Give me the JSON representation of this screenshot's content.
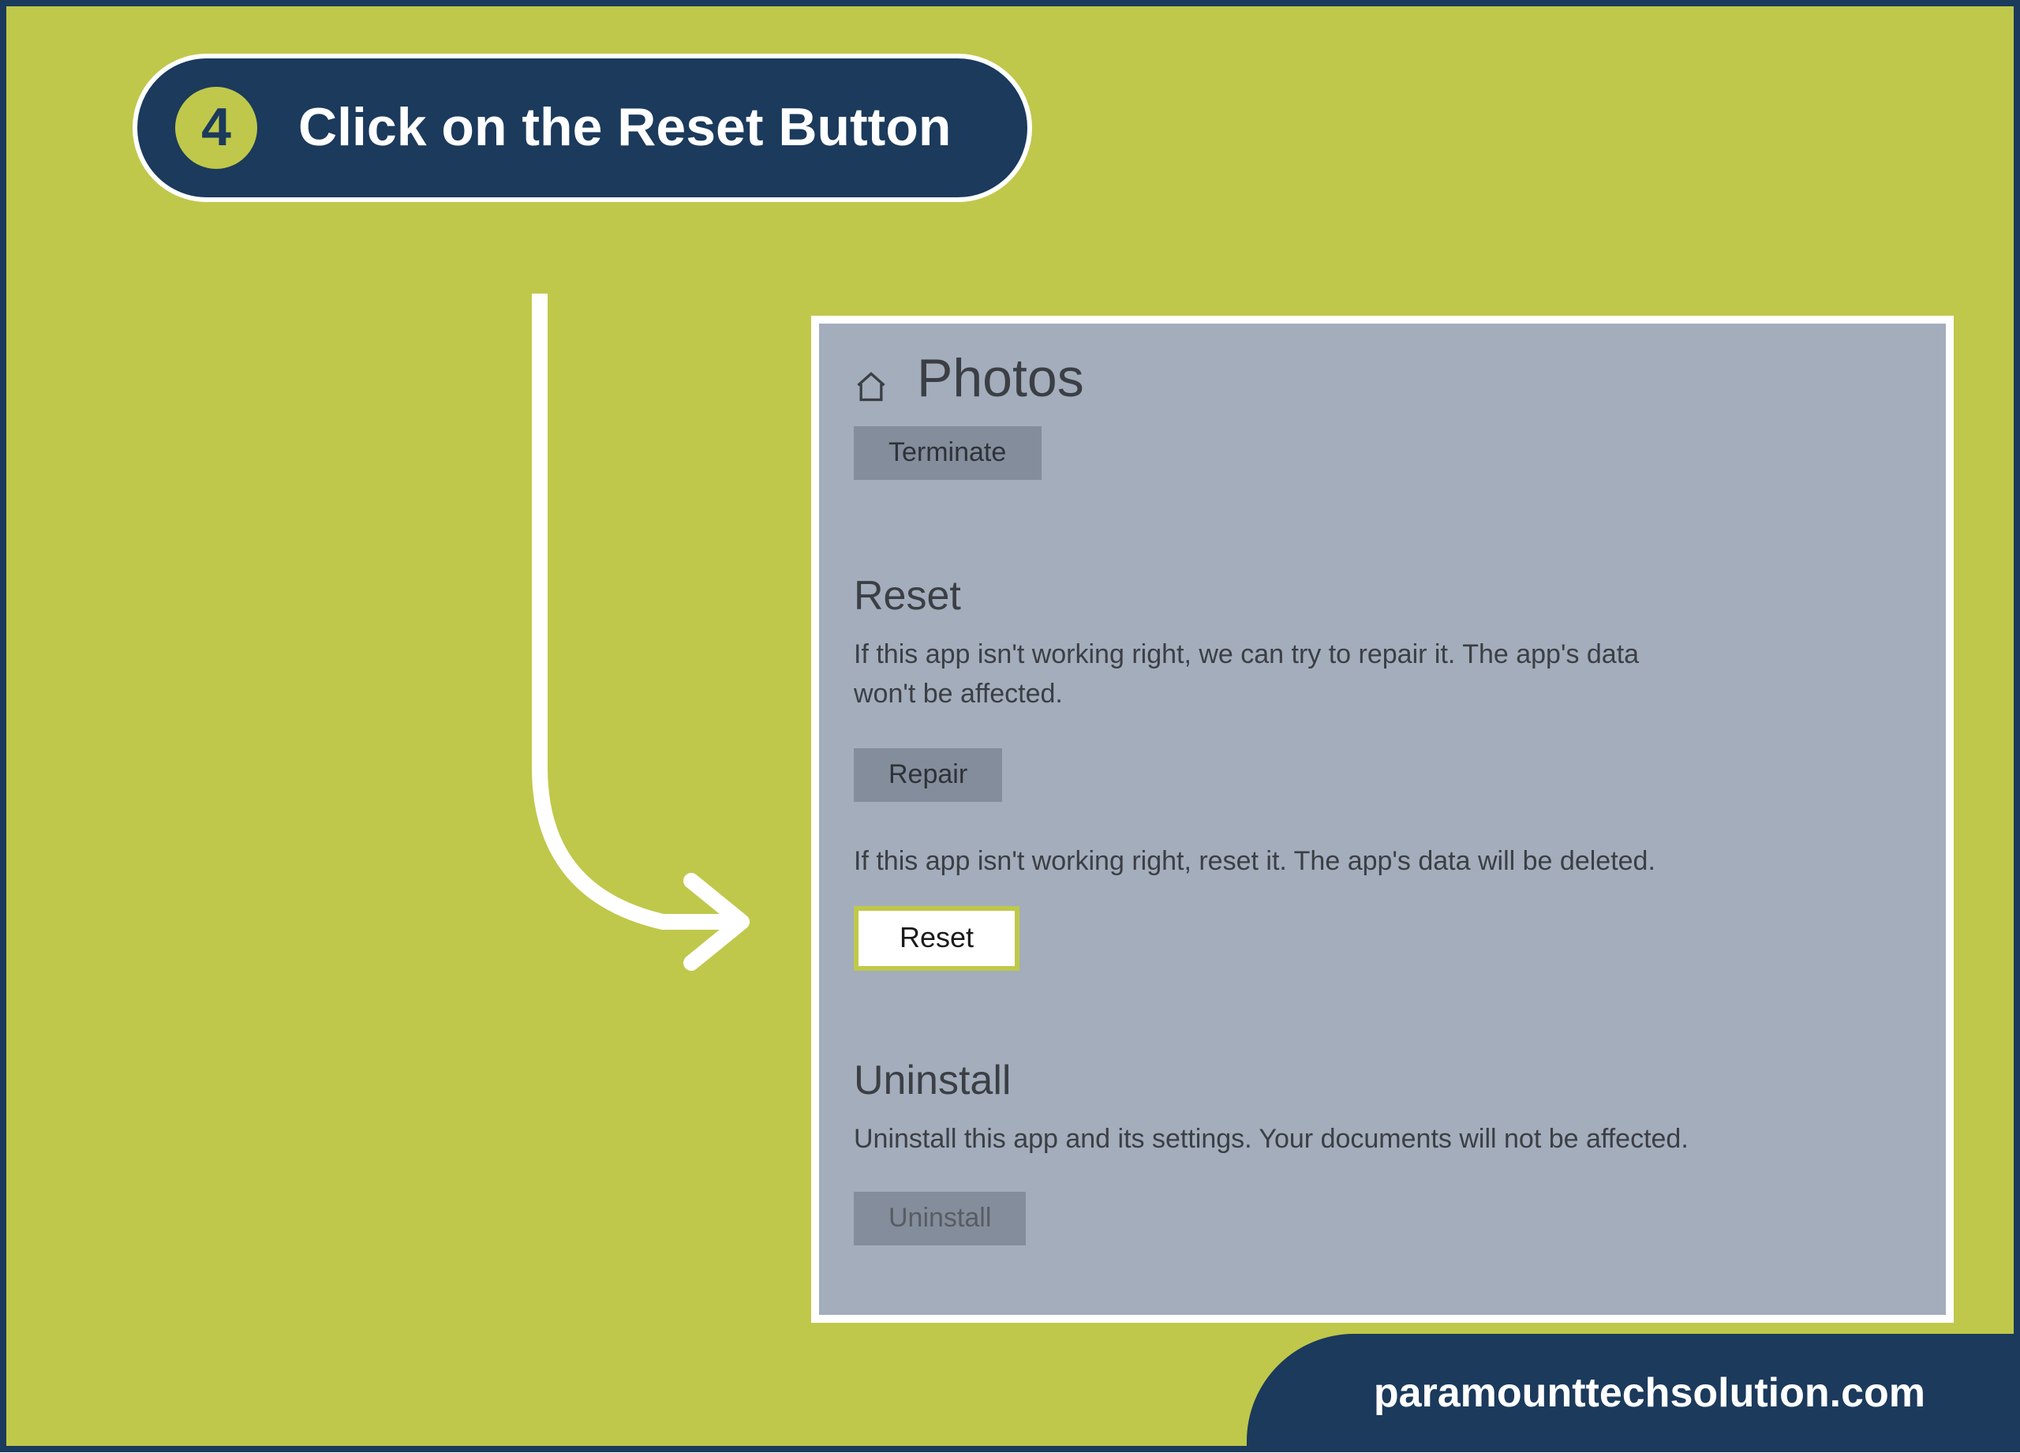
{
  "step": {
    "number": "4",
    "title": "Click on the Reset Button"
  },
  "panel": {
    "title": "Photos",
    "terminate_label": "Terminate",
    "reset_heading": "Reset",
    "repair_desc": "If this app isn't working right, we can try to repair it. The app's data won't be affected.",
    "repair_label": "Repair",
    "reset_desc": "If this app isn't working right, reset it. The app's data will be deleted.",
    "reset_label": "Reset",
    "uninstall_heading": "Uninstall",
    "uninstall_desc": "Uninstall this app and its settings. Your documents will not be affected.",
    "uninstall_label": "Uninstall"
  },
  "footer": {
    "text": "paramounttechsolution.com"
  }
}
